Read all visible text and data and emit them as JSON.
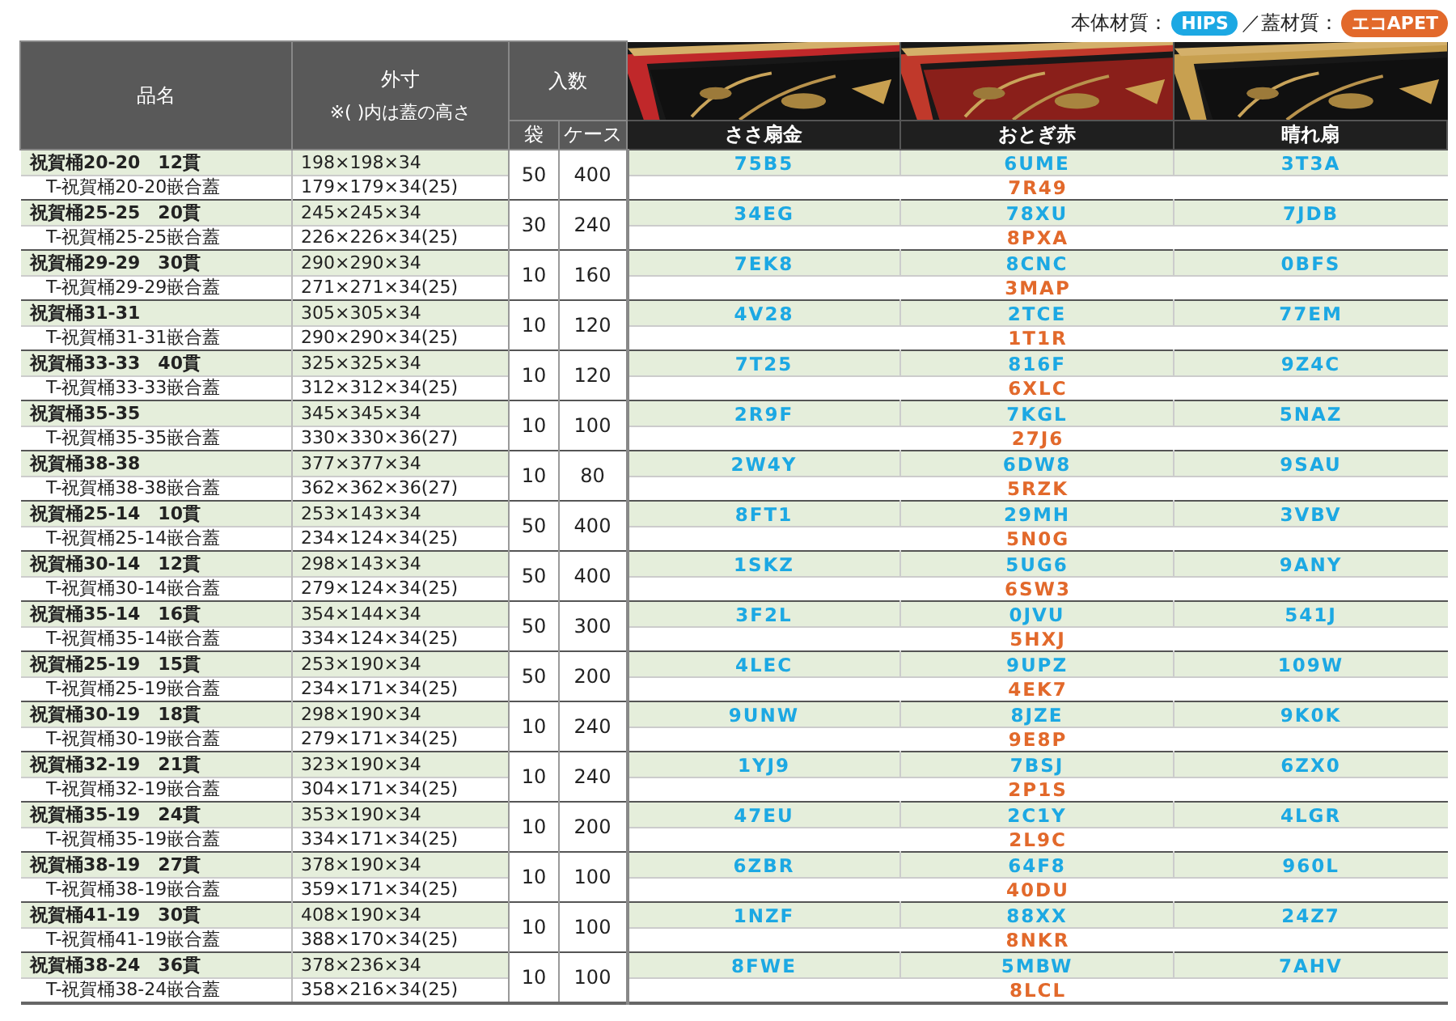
{
  "legend": [
    {
      "label": "本体材質：",
      "badge": "HIPS",
      "color": "#1ca8e3"
    },
    {
      "label": "／蓋材質：",
      "badge": "エコAPET",
      "color": "#e2692b"
    }
  ],
  "header": {
    "name": "品名",
    "size": "外寸",
    "size_note": "※( )内は蓋の高さ",
    "qty": "入数",
    "bag": "袋",
    "case": "ケース",
    "colors": [
      {
        "name": "ささ扇金"
      },
      {
        "name": "おとぎ赤"
      },
      {
        "name": "晴れ扇"
      }
    ]
  },
  "rows": [
    {
      "name": "祝賀桶20-20　12貫",
      "lid": "T-祝賀桶20-20嵌合蓋",
      "size": "198×198×34",
      "lid_size": "179×179×34(25)",
      "bag": "50",
      "case": "400",
      "codes": [
        "75B5",
        "6UME",
        "3T3A"
      ],
      "lid_code": "7R49"
    },
    {
      "name": "祝賀桶25-25　20貫",
      "lid": "T-祝賀桶25-25嵌合蓋",
      "size": "245×245×34",
      "lid_size": "226×226×34(25)",
      "bag": "30",
      "case": "240",
      "codes": [
        "34EG",
        "78XU",
        "7JDB"
      ],
      "lid_code": "8PXA"
    },
    {
      "name": "祝賀桶29-29　30貫",
      "lid": "T-祝賀桶29-29嵌合蓋",
      "size": "290×290×34",
      "lid_size": "271×271×34(25)",
      "bag": "10",
      "case": "160",
      "codes": [
        "7EK8",
        "8CNC",
        "0BFS"
      ],
      "lid_code": "3MAP"
    },
    {
      "name": "祝賀桶31-31",
      "lid": "T-祝賀桶31-31嵌合蓋",
      "size": "305×305×34",
      "lid_size": "290×290×34(25)",
      "bag": "10",
      "case": "120",
      "codes": [
        "4V28",
        "2TCE",
        "77EM"
      ],
      "lid_code": "1T1R"
    },
    {
      "name": "祝賀桶33-33　40貫",
      "lid": "T-祝賀桶33-33嵌合蓋",
      "size": "325×325×34",
      "lid_size": "312×312×34(25)",
      "bag": "10",
      "case": "120",
      "codes": [
        "7T25",
        "816F",
        "9Z4C"
      ],
      "lid_code": "6XLC"
    },
    {
      "name": "祝賀桶35-35",
      "lid": "T-祝賀桶35-35嵌合蓋",
      "size": "345×345×34",
      "lid_size": "330×330×36(27)",
      "bag": "10",
      "case": "100",
      "codes": [
        "2R9F",
        "7KGL",
        "5NAZ"
      ],
      "lid_code": "27J6"
    },
    {
      "name": "祝賀桶38-38",
      "lid": "T-祝賀桶38-38嵌合蓋",
      "size": "377×377×34",
      "lid_size": "362×362×36(27)",
      "bag": "10",
      "case": "80",
      "codes": [
        "2W4Y",
        "6DW8",
        "9SAU"
      ],
      "lid_code": "5RZK"
    },
    {
      "name": "祝賀桶25-14　10貫",
      "lid": "T-祝賀桶25-14嵌合蓋",
      "size": "253×143×34",
      "lid_size": "234×124×34(25)",
      "bag": "50",
      "case": "400",
      "codes": [
        "8FT1",
        "29MH",
        "3VBV"
      ],
      "lid_code": "5N0G"
    },
    {
      "name": "祝賀桶30-14　12貫",
      "lid": "T-祝賀桶30-14嵌合蓋",
      "size": "298×143×34",
      "lid_size": "279×124×34(25)",
      "bag": "50",
      "case": "400",
      "codes": [
        "1SKZ",
        "5UG6",
        "9ANY"
      ],
      "lid_code": "6SW3"
    },
    {
      "name": "祝賀桶35-14　16貫",
      "lid": "T-祝賀桶35-14嵌合蓋",
      "size": "354×144×34",
      "lid_size": "334×124×34(25)",
      "bag": "50",
      "case": "300",
      "codes": [
        "3F2L",
        "0JVU",
        "541J"
      ],
      "lid_code": "5HXJ"
    },
    {
      "name": "祝賀桶25-19　15貫",
      "lid": "T-祝賀桶25-19嵌合蓋",
      "size": "253×190×34",
      "lid_size": "234×171×34(25)",
      "bag": "50",
      "case": "200",
      "codes": [
        "4LEC",
        "9UPZ",
        "109W"
      ],
      "lid_code": "4EK7"
    },
    {
      "name": "祝賀桶30-19　18貫",
      "lid": "T-祝賀桶30-19嵌合蓋",
      "size": "298×190×34",
      "lid_size": "279×171×34(25)",
      "bag": "10",
      "case": "240",
      "codes": [
        "9UNW",
        "8JZE",
        "9K0K"
      ],
      "lid_code": "9E8P"
    },
    {
      "name": "祝賀桶32-19　21貫",
      "lid": "T-祝賀桶32-19嵌合蓋",
      "size": "323×190×34",
      "lid_size": "304×171×34(25)",
      "bag": "10",
      "case": "240",
      "codes": [
        "1YJ9",
        "7BSJ",
        "6ZX0"
      ],
      "lid_code": "2P1S"
    },
    {
      "name": "祝賀桶35-19　24貫",
      "lid": "T-祝賀桶35-19嵌合蓋",
      "size": "353×190×34",
      "lid_size": "334×171×34(25)",
      "bag": "10",
      "case": "200",
      "codes": [
        "47EU",
        "2C1Y",
        "4LGR"
      ],
      "lid_code": "2L9C"
    },
    {
      "name": "祝賀桶38-19　27貫",
      "lid": "T-祝賀桶38-19嵌合蓋",
      "size": "378×190×34",
      "lid_size": "359×171×34(25)",
      "bag": "10",
      "case": "100",
      "codes": [
        "6ZBR",
        "64F8",
        "960L"
      ],
      "lid_code": "40DU"
    },
    {
      "name": "祝賀桶41-19　30貫",
      "lid": "T-祝賀桶41-19嵌合蓋",
      "size": "408×190×34",
      "lid_size": "388×170×34(25)",
      "bag": "10",
      "case": "100",
      "codes": [
        "1NZF",
        "88XX",
        "24Z7"
      ],
      "lid_code": "8NKR"
    },
    {
      "name": "祝賀桶38-24　36貫",
      "lid": "T-祝賀桶38-24嵌合蓋",
      "size": "378×236×34",
      "lid_size": "358×216×34(25)",
      "bag": "10",
      "case": "100",
      "codes": [
        "8FWE",
        "5MBW",
        "7AHV"
      ],
      "lid_code": "8LCL"
    }
  ]
}
